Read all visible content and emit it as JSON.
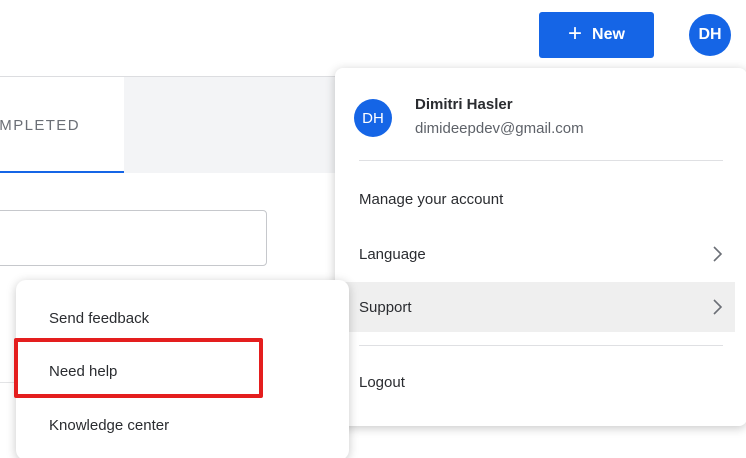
{
  "header": {
    "new_button": {
      "icon": "plus-icon",
      "label": "New"
    },
    "avatar_initials": "DH"
  },
  "tabs": {
    "completed_label": "COMPLETED"
  },
  "account_menu": {
    "avatar_initials": "DH",
    "user_name": "Dimitri Hasler",
    "user_email": "dimideepdev@gmail.com",
    "items": [
      {
        "label": "Manage your account",
        "has_submenu": false
      },
      {
        "label": "Language",
        "has_submenu": true,
        "icon": "chevron-right-icon"
      },
      {
        "label": "Support",
        "has_submenu": true,
        "icon": "chevron-right-icon",
        "active": true
      },
      {
        "label": "Logout",
        "has_submenu": false
      }
    ]
  },
  "support_submenu": {
    "items": [
      {
        "label": "Send feedback"
      },
      {
        "label": "Need help",
        "highlighted": true
      },
      {
        "label": "Knowledge center"
      }
    ]
  },
  "colors": {
    "brand_blue": "#1565e6",
    "highlight_red": "#e41e1e",
    "active_item_bg": "#efefef"
  }
}
